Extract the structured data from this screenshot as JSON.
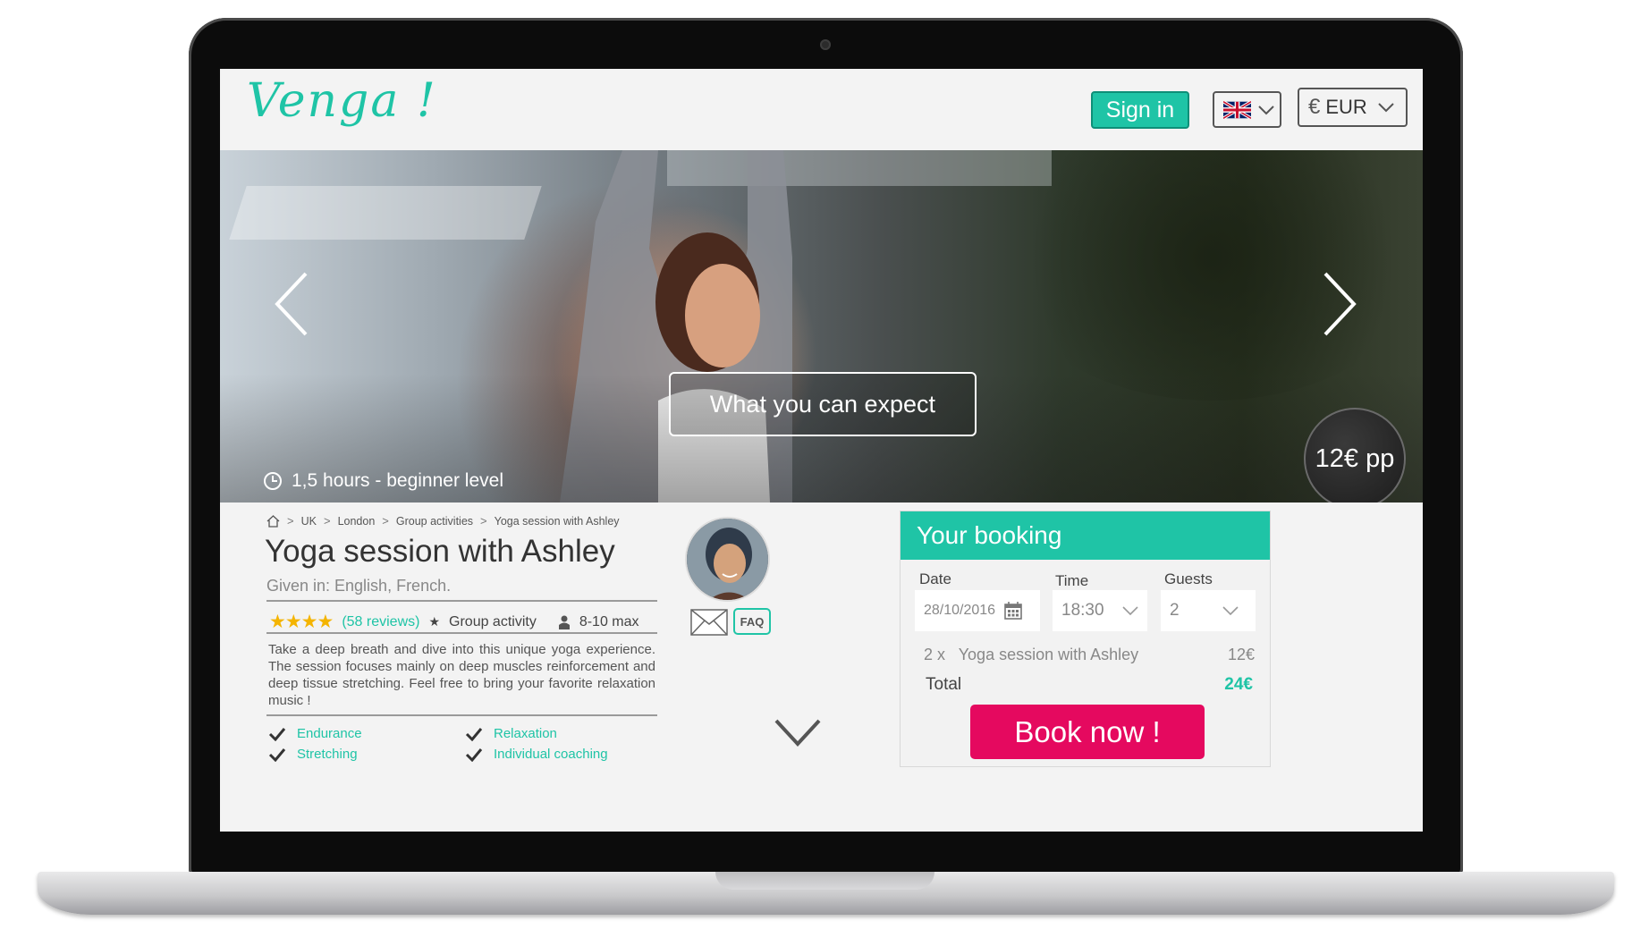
{
  "header": {
    "logo": "Venga !",
    "signin_label": "Sign in",
    "language": {
      "icon": "uk-flag-icon"
    },
    "currency": {
      "icon": "euro-icon",
      "label": "EUR"
    }
  },
  "hero": {
    "cta_label": "What you can expect",
    "duration": "1,5 hours - beginner level",
    "price": "12€ pp"
  },
  "breadcrumb": {
    "items": [
      "UK",
      "London",
      "Group activities",
      "Yoga session with Ashley"
    ]
  },
  "activity": {
    "title": "Yoga session with Ashley",
    "given_in": "Given in: English, French.",
    "stars": "★★★★",
    "reviews": "(58 reviews)",
    "type": "Group activity",
    "group_size": "8-10 max",
    "description": "Take a deep breath and dive into this unique yoga experience. The session focuses mainly on deep muscles reinforcement and deep tissue stretching. Feel free to bring your favorite relaxation music !",
    "features": [
      "Endurance",
      "Relaxation",
      "Stretching",
      "Individual coaching"
    ]
  },
  "host": {
    "faq_label": "FAQ"
  },
  "booking": {
    "title": "Your booking",
    "date_label": "Date",
    "date_value": "28/10/2016",
    "time_label": "Time",
    "time_value": "18:30",
    "guests_label": "Guests",
    "guests_value": "2",
    "line_item": "2 x   Yoga session with Ashley",
    "line_price": "12€",
    "total_label": "Total",
    "total_value": "24€",
    "book_label": "Book now !"
  },
  "colors": {
    "accent": "#1fc4a6",
    "cta": "#e5095f",
    "stars": "#f4b400"
  }
}
